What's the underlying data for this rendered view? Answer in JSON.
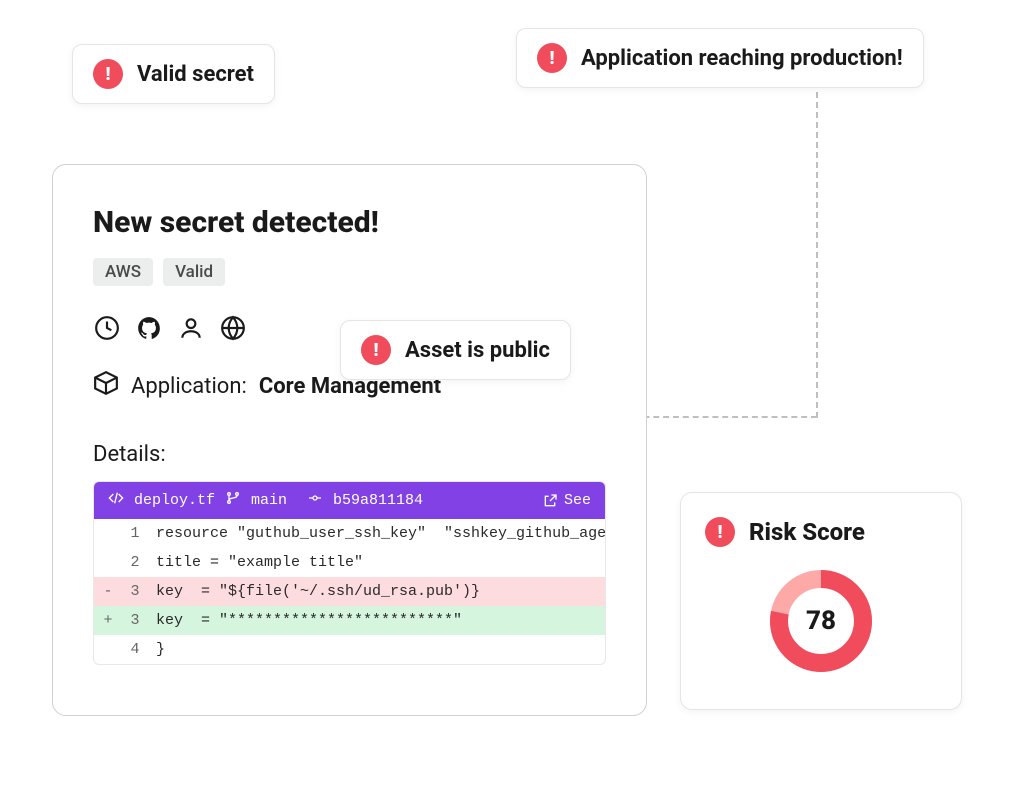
{
  "callouts": {
    "valid_secret": "Valid secret",
    "app_production": "Application reaching production!",
    "asset_public": "Asset is public"
  },
  "card": {
    "title": "New secret detected!",
    "tags": [
      "AWS",
      "Valid"
    ],
    "application_label": "Application:",
    "application_name": "Core Management",
    "details_label": "Details:",
    "code": {
      "filename": "deploy.tf",
      "branch": "main",
      "commit": "b59a811184",
      "see_label": "See",
      "lines": [
        {
          "prefix": "",
          "num": "1",
          "content": "resource \"guthub_user_ssh_key\"  \"sshkey_github_agent\" {",
          "cls": ""
        },
        {
          "prefix": "",
          "num": "2",
          "content": "title = \"example title\"",
          "cls": ""
        },
        {
          "prefix": "-",
          "num": "3",
          "content": "key  = \"${file('~/.ssh/ud_rsa.pub')}",
          "cls": "line-removed"
        },
        {
          "prefix": "+",
          "num": "3",
          "content": "key  = \"*************************\"",
          "cls": "line-added"
        },
        {
          "prefix": "",
          "num": "4",
          "content": "}",
          "cls": ""
        }
      ]
    }
  },
  "risk": {
    "title": "Risk Score",
    "value": "78"
  }
}
